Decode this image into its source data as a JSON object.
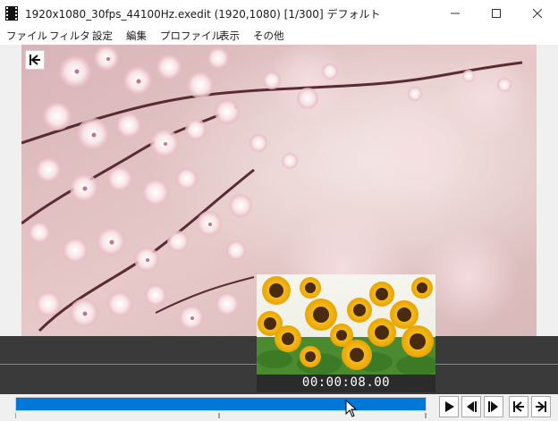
{
  "window": {
    "title": "1920x1080_30fps_44100Hz.exedit (1920,1080)  [1/300]  デフォルト"
  },
  "menu": {
    "items": [
      "ファイル",
      "フィルタ",
      "設定",
      "編集",
      "プロファイル",
      "表示",
      "その他"
    ]
  },
  "preview": {
    "thumbnail_time": "00:00:08.00"
  },
  "seek": {
    "progress": 0.78
  },
  "controls": {
    "buttons": [
      "play",
      "prev-frame",
      "next-frame",
      "go-start",
      "go-end"
    ]
  },
  "colors": {
    "accent": "#0078d7",
    "timeline_bg": "#3a3a3a",
    "timeline_line": "#2fbf2f"
  }
}
